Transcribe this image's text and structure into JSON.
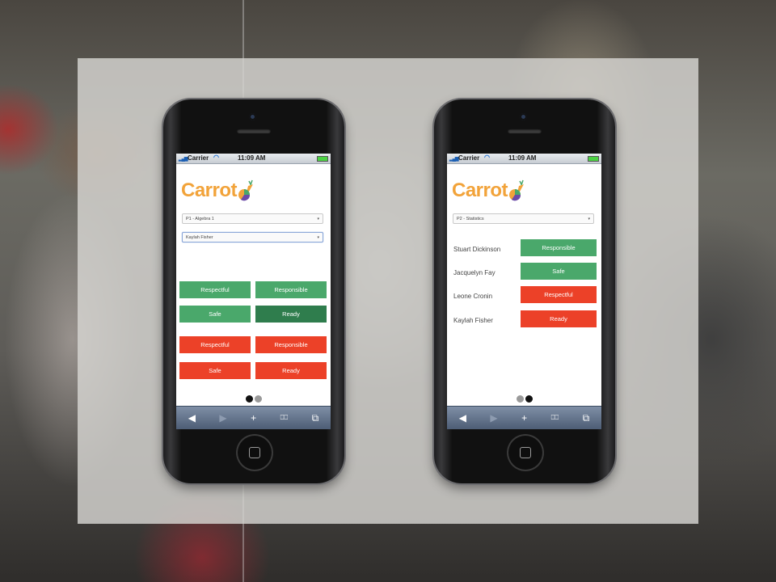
{
  "status_bar": {
    "carrier": "Carrier",
    "time": "11:09 AM"
  },
  "app": {
    "logo_text": "Carrot"
  },
  "left_screen": {
    "class_select": "P1 - Algebra 1",
    "student_select": "Kaylah Fisher",
    "buttons": [
      {
        "label": "Respectful",
        "color": "#4aa86b"
      },
      {
        "label": "Responsible",
        "color": "#4aa86b"
      },
      {
        "label": "Safe",
        "color": "#4aa86b"
      },
      {
        "label": "Ready",
        "color": "#2f7d4d"
      },
      {
        "label": "Respectful",
        "color": "#ec4128"
      },
      {
        "label": "Responsible",
        "color": "#ec4128"
      },
      {
        "label": "Safe",
        "color": "#ec4128"
      },
      {
        "label": "Ready",
        "color": "#ec4128"
      }
    ],
    "page_indicator": {
      "current": 1,
      "total": 2
    }
  },
  "right_screen": {
    "class_select": "P2 - Statistics",
    "students": [
      {
        "name": "Stuart Dickinson",
        "badge": "Responsible",
        "color": "#4aa86b"
      },
      {
        "name": "Jacquelyn Fay",
        "badge": "Safe",
        "color": "#4aa86b"
      },
      {
        "name": "Leone Cronin",
        "badge": "Respectful",
        "color": "#ec4128"
      },
      {
        "name": "Kaylah Fisher",
        "badge": "Ready",
        "color": "#ec4128"
      }
    ],
    "page_indicator": {
      "current": 2,
      "total": 2
    }
  },
  "toolbar": {
    "back": "◀",
    "forward": "▶",
    "add": "+",
    "bookmarks": "⎕⎕",
    "tabs": "⧉"
  },
  "colors": {
    "brand_orange": "#f2a33a",
    "positive_green": "#4aa86b",
    "selected_green": "#2f7d4d",
    "negative_red": "#ec4128"
  }
}
